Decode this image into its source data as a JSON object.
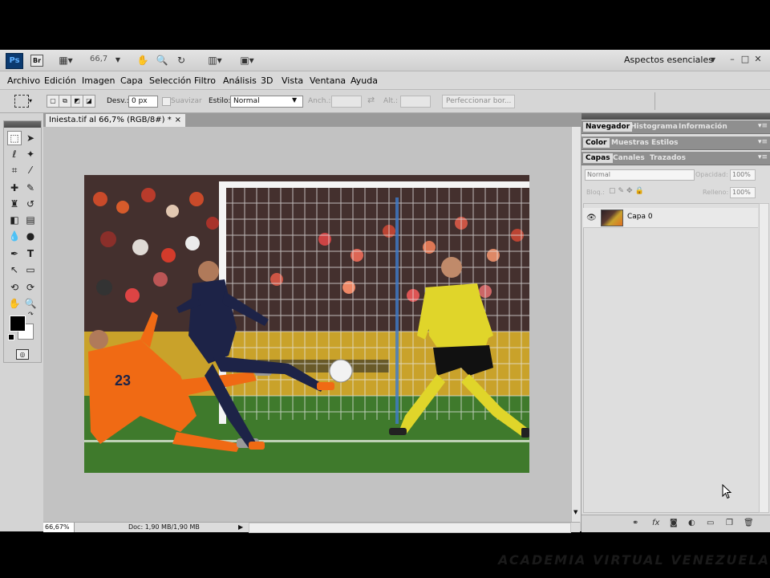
{
  "app": {
    "logo": "Ps",
    "bridge_logo": "Br",
    "zoom_value": "66,7",
    "workspace": "Aspectos esenciales"
  },
  "window_controls": {
    "minimize": "–",
    "maximize": "□",
    "close": "✕"
  },
  "menu": [
    "Archivo",
    "Edición",
    "Imagen",
    "Capa",
    "Selección",
    "Filtro",
    "Análisis",
    "3D",
    "Vista",
    "Ventana",
    "Ayuda"
  ],
  "options": {
    "feather_label": "Desv.:",
    "feather_value": "0 px",
    "antialias_label": "Suavizar",
    "style_label": "Estilo:",
    "style_value": "Normal",
    "width_label": "Anch.:",
    "height_label": "Alt.:",
    "refine_button": "Perfeccionar bor..."
  },
  "document": {
    "tab_title": "Iniesta.tif al 66,7% (RGB/8#) *",
    "tab_close": "×",
    "zoom_status": "66,67%",
    "doc_status": "Doc: 1,90 MB/1,90 MB"
  },
  "panels": {
    "group1": [
      "Navegador",
      "Histograma",
      "Información"
    ],
    "group2": [
      "Color",
      "Muestras",
      "Estilos"
    ],
    "group3": [
      "Capas",
      "Canales",
      "Trazados"
    ],
    "blend_mode": "Normal",
    "opacity_label": "Opacidad:",
    "opacity_value": "100%",
    "lock_label": "Bloq.:",
    "fill_label": "Relleno:",
    "fill_value": "100%",
    "layer_name": "Capa 0"
  },
  "watermark": "ACADEMIA VIRTUAL VENEZUELA",
  "colors": {
    "ps_blue": "#0b3a70",
    "orange_kit": "#f06a14",
    "navy_kit": "#1d2347",
    "keeper_yellow": "#e0d52a",
    "pitch_green": "#3f7a2c"
  }
}
